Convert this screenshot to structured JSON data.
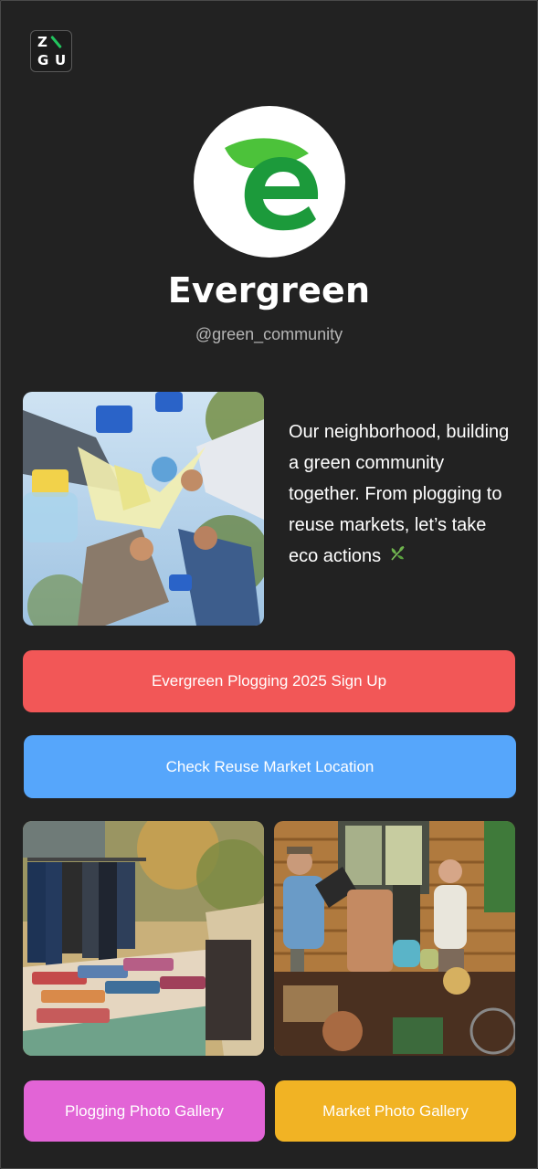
{
  "brand": {
    "logo_letters": [
      "Z",
      "G",
      "U"
    ],
    "accent_color": "#22c55e"
  },
  "profile": {
    "name": "Evergreen",
    "handle": "@green_community",
    "avatar_icon": "evergreen-leaf-e-logo"
  },
  "intro": {
    "text": "Our neighborhood, building a green community together. From plogging to reuse markets, let’s take eco actions",
    "emoji": "herb-emoji"
  },
  "images": {
    "plogging_group": "volunteers with gloves and bags photo",
    "market_clothes": "outdoor market clothing racks photo",
    "market_people": "people at reuse market stall photo"
  },
  "buttons": {
    "signup": "Evergreen Plogging 2025 Sign Up",
    "location": "Check Reuse Market Location",
    "plogging_gallery": "Plogging Photo Gallery",
    "market_gallery": "Market Photo Gallery"
  },
  "colors": {
    "background": "#222222",
    "signup": "#f25757",
    "location": "#56a6fb",
    "plogging_gallery": "#e264d6",
    "market_gallery": "#f1b324"
  }
}
